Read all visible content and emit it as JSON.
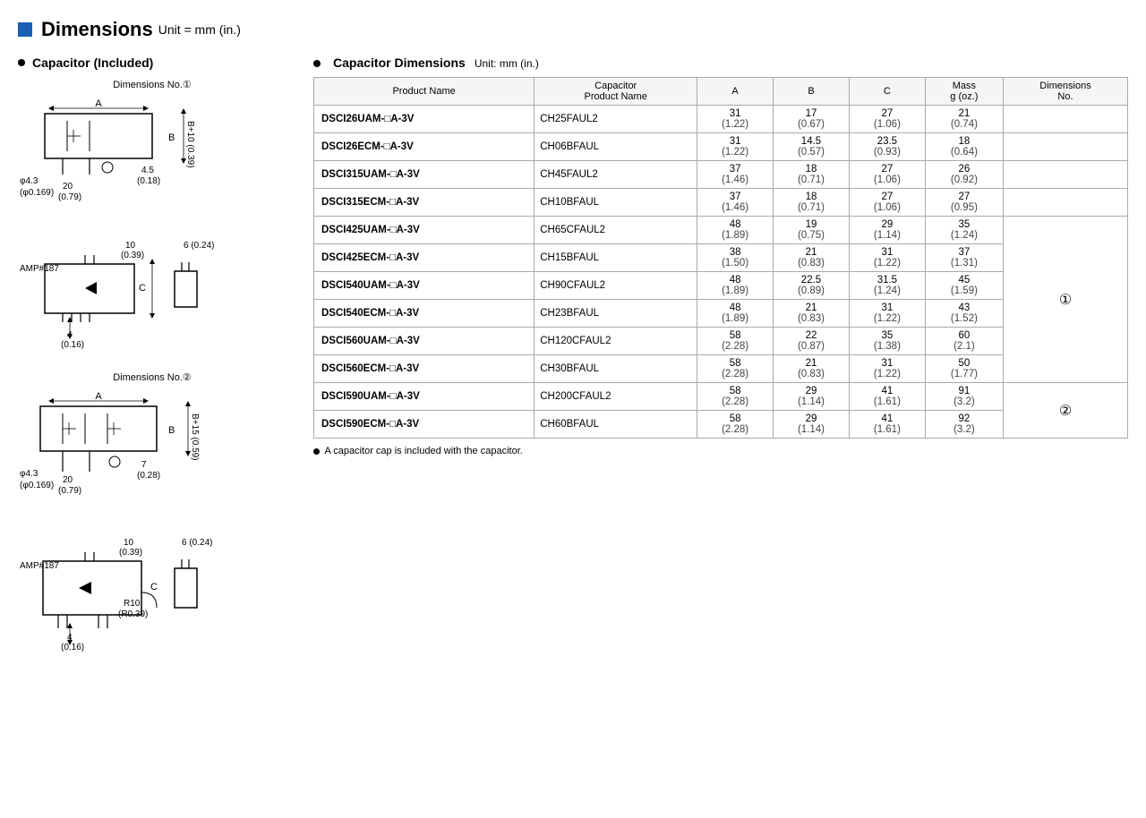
{
  "header": {
    "blue_square": true,
    "title": "Dimensions",
    "unit": "Unit = mm (in.)"
  },
  "left": {
    "section_title": "Capacitor (Included)",
    "diagram1_label": "Dimensions No.①",
    "diagram2_label": "Dimensions No.②"
  },
  "right": {
    "table_section_title": "Capacitor Dimensions",
    "table_unit": "Unit: mm (in.)",
    "columns": [
      {
        "key": "product_name",
        "label": "Product Name"
      },
      {
        "key": "cap_product_name",
        "label": "Capacitor\nProduct Name"
      },
      {
        "key": "A",
        "label": "A"
      },
      {
        "key": "B",
        "label": "B"
      },
      {
        "key": "C",
        "label": "C"
      },
      {
        "key": "mass",
        "label": "Mass\ng (oz.)"
      },
      {
        "key": "dim_no",
        "label": "Dimensions\nNo."
      }
    ],
    "rows": [
      {
        "product": "DSCI26UAM-□A-3V",
        "cap": "CH25FAUL2",
        "A": "31\n(1.22)",
        "B": "17\n(0.67)",
        "C": "27\n(1.06)",
        "mass": "21\n(0.74)",
        "dim": ""
      },
      {
        "product": "DSCI26ECM-□A-3V",
        "cap": "CH06BFAUL",
        "A": "31\n(1.22)",
        "B": "14.5\n(0.57)",
        "C": "23.5\n(0.93)",
        "mass": "18\n(0.64)",
        "dim": ""
      },
      {
        "product": "DSCI315UAM-□A-3V",
        "cap": "CH45FAUL2",
        "A": "37\n(1.46)",
        "B": "18\n(0.71)",
        "C": "27\n(1.06)",
        "mass": "26\n(0.92)",
        "dim": ""
      },
      {
        "product": "DSCI315ECM-□A-3V",
        "cap": "CH10BFAUL",
        "A": "37\n(1.46)",
        "B": "18\n(0.71)",
        "C": "27\n(1.06)",
        "mass": "27\n(0.95)",
        "dim": ""
      },
      {
        "product": "DSCI425UAM-□A-3V",
        "cap": "CH65CFAUL2",
        "A": "48\n(1.89)",
        "B": "19\n(0.75)",
        "C": "29\n(1.14)",
        "mass": "35\n(1.24)",
        "dim": "①",
        "rowspan": 8
      },
      {
        "product": "DSCI425ECM-□A-3V",
        "cap": "CH15BFAUL",
        "A": "38\n(1.50)",
        "B": "21\n(0.83)",
        "C": "31\n(1.22)",
        "mass": "37\n(1.31)",
        "dim": ""
      },
      {
        "product": "DSCI540UAM-□A-3V",
        "cap": "CH90CFAUL2",
        "A": "48\n(1.89)",
        "B": "22.5\n(0.89)",
        "C": "31.5\n(1.24)",
        "mass": "45\n(1.59)",
        "dim": ""
      },
      {
        "product": "DSCI540ECM-□A-3V",
        "cap": "CH23BFAUL",
        "A": "48\n(1.89)",
        "B": "21\n(0.83)",
        "C": "31\n(1.22)",
        "mass": "43\n(1.52)",
        "dim": ""
      },
      {
        "product": "DSCI560UAM-□A-3V",
        "cap": "CH120CFAUL2",
        "A": "58\n(2.28)",
        "B": "22\n(0.87)",
        "C": "35\n(1.38)",
        "mass": "60\n(2.1)",
        "dim": ""
      },
      {
        "product": "DSCI560ECM-□A-3V",
        "cap": "CH30BFAUL",
        "A": "58\n(2.28)",
        "B": "21\n(0.83)",
        "C": "31\n(1.22)",
        "mass": "50\n(1.77)",
        "dim": ""
      },
      {
        "product": "DSCI590UAM-□A-3V",
        "cap": "CH200CFAUL2",
        "A": "58\n(2.28)",
        "B": "29\n(1.14)",
        "C": "41\n(1.61)",
        "mass": "91\n(3.2)",
        "dim": "②",
        "rowspan": 2
      },
      {
        "product": "DSCI590ECM-□A-3V",
        "cap": "CH60BFAUL",
        "A": "58\n(2.28)",
        "B": "29\n(1.14)",
        "C": "41\n(1.61)",
        "mass": "92\n(3.2)",
        "dim": ""
      }
    ],
    "footnote": "A capacitor cap is included with the capacitor."
  }
}
